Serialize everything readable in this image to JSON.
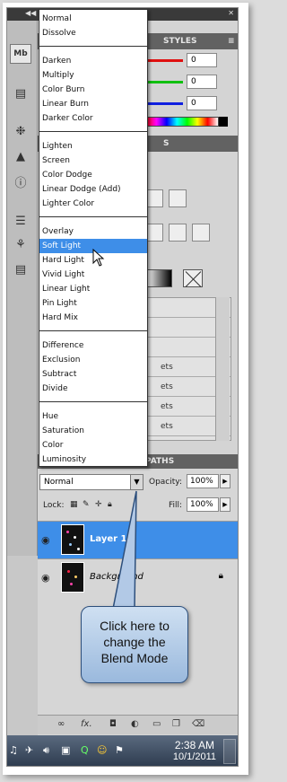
{
  "panels": {
    "styles_tab": "STYLES",
    "adjust_tab": "S",
    "paths_tab": "PATHS",
    "color_values": [
      "0",
      "0",
      "0"
    ],
    "action_rows": [
      "",
      "",
      "",
      "ets",
      "ets",
      "ets",
      "ets"
    ]
  },
  "blend_menu": {
    "groups": [
      [
        "Normal",
        "Dissolve"
      ],
      [
        "Darken",
        "Multiply",
        "Color Burn",
        "Linear Burn",
        "Darker Color"
      ],
      [
        "Lighten",
        "Screen",
        "Color Dodge",
        "Linear Dodge (Add)",
        "Lighter Color"
      ],
      [
        "Overlay",
        "Soft Light",
        "Hard Light",
        "Vivid Light",
        "Linear Light",
        "Pin Light",
        "Hard Mix"
      ],
      [
        "Difference",
        "Exclusion",
        "Subtract",
        "Divide"
      ],
      [
        "Hue",
        "Saturation",
        "Color",
        "Luminosity"
      ]
    ],
    "highlighted": "Soft Light"
  },
  "layers": {
    "blend_mode": "Normal",
    "opacity_label": "Opacity:",
    "opacity_value": "100%",
    "lock_label": "Lock:",
    "fill_label": "Fill:",
    "fill_value": "100%",
    "rows": [
      {
        "name": "Layer 1",
        "selected": true
      },
      {
        "name": "Background",
        "selected": false
      }
    ]
  },
  "callout": {
    "line1": "Click here to",
    "line2": "change the",
    "line3": "Blend Mode"
  },
  "taskbar": {
    "time": "2:38 AM",
    "date": "10/1/2011"
  },
  "colors": {
    "selection_blue": "#3e8ee8",
    "panel_tab": "#626262",
    "taskbar": "#2c3a4d"
  }
}
